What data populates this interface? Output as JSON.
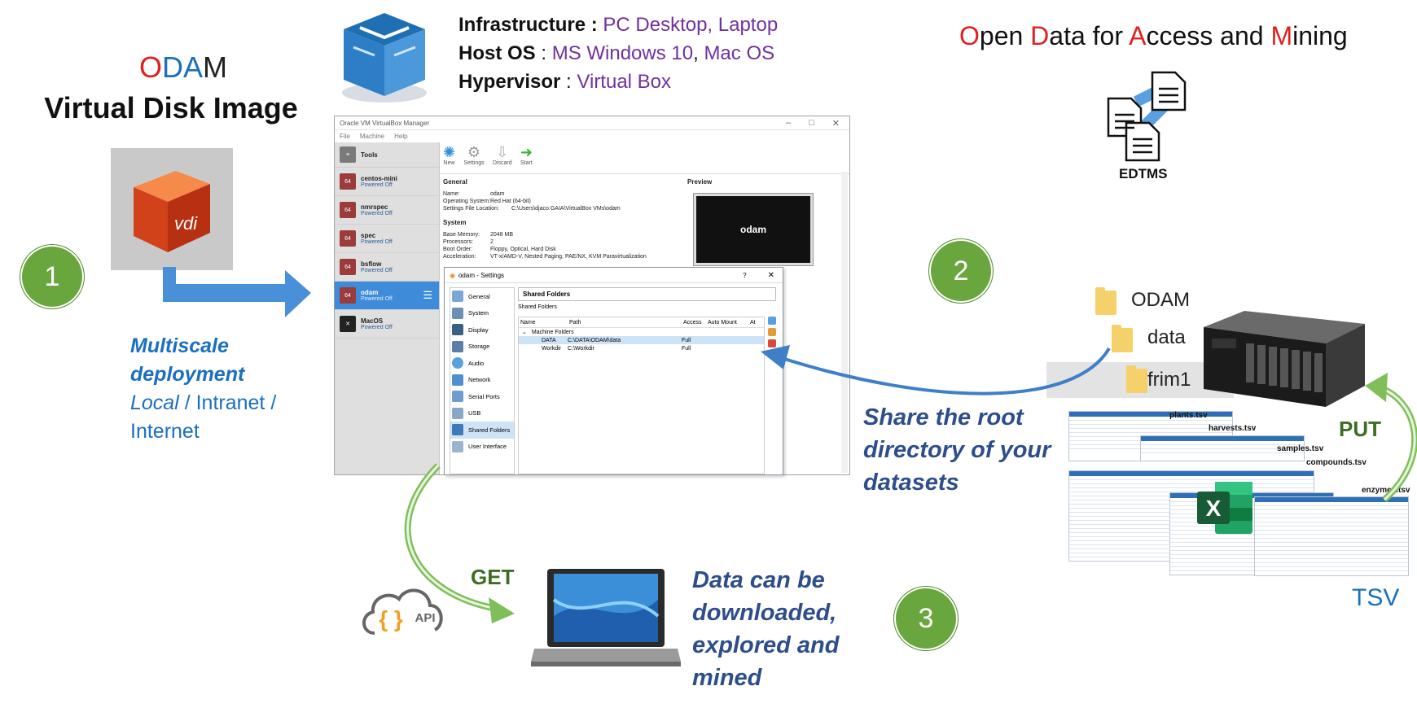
{
  "title": {
    "letters": [
      "O",
      "D",
      "A",
      "M"
    ],
    "subtitle": "Virtual Disk Image"
  },
  "vdi_icon_label": "vdi",
  "steps": [
    "1",
    "2",
    "3"
  ],
  "infra": {
    "infrastructure_label": "Infrastructure :",
    "infrastructure_value": "PC Desktop, Laptop",
    "hostos_label": "Host OS",
    "hostos_sep": " : ",
    "hostos_value1": "MS Windows 10",
    "hostos_comma": ", ",
    "hostos_value2": "Mac OS",
    "hypervisor_label": "Hypervisor",
    "hypervisor_sep": " : ",
    "hypervisor_value": "Virtual Box"
  },
  "odam_full": {
    "parts": [
      {
        "initial": "O",
        "rest": "pen "
      },
      {
        "initial": "D",
        "rest": "ata for "
      },
      {
        "initial": "A",
        "rest": "ccess and "
      },
      {
        "initial": "M",
        "rest": "ining"
      }
    ]
  },
  "edtms_label": "EDTMS",
  "deployment": {
    "line1": "Multiscale",
    "line2": "deployment",
    "local": "Local",
    "sep1": " / Intranet /",
    "internet": "Internet"
  },
  "vbox": {
    "window_title": "Oracle VM VirtualBox Manager",
    "menu": [
      "File",
      "Machine",
      "Help"
    ],
    "tools_label": "Tools",
    "vms": [
      {
        "name": "centos-mini",
        "state": "Powered Off"
      },
      {
        "name": "nmrspec",
        "state": "Powered Off"
      },
      {
        "name": "spec",
        "state": "Powered Off"
      },
      {
        "name": "bsflow",
        "state": "Powered Off"
      },
      {
        "name": "odam",
        "state": "Powered Off"
      },
      {
        "name": "MacOS",
        "state": "Powered Off"
      }
    ],
    "toolbar": [
      "New",
      "Settings",
      "Discard",
      "Start"
    ],
    "general_label": "General",
    "general": [
      {
        "k": "Name:",
        "v": "odam"
      },
      {
        "k": "Operating System:",
        "v": "Red Hat (64-bit)"
      },
      {
        "k": "Settings File Location:",
        "v": "C:\\Users\\djaco.GAIA\\VirtualBox VMs\\odam"
      }
    ],
    "system_label": "System",
    "system": [
      {
        "k": "Base Memory:",
        "v": "2048 MB"
      },
      {
        "k": "Processors:",
        "v": "2"
      },
      {
        "k": "Boot Order:",
        "v": "Floppy, Optical, Hard Disk"
      },
      {
        "k": "Acceleration:",
        "v": "VT-x/AMD-V, Nested Paging, PAE/NX, KVM Paravirtualization"
      }
    ],
    "preview_label": "Preview",
    "preview_name": "odam"
  },
  "settings": {
    "title": "odam - Settings",
    "help": "?",
    "close": "✕",
    "nav": [
      "General",
      "System",
      "Display",
      "Storage",
      "Audio",
      "Network",
      "Serial Ports",
      "USB",
      "Shared Folders",
      "User Interface"
    ],
    "header": "Shared Folders",
    "group_label": "Shared Folders",
    "columns": [
      "Name",
      "Path",
      "Access",
      "Auto Mount",
      "At"
    ],
    "machine_folders": "Machine Folders",
    "rows": [
      {
        "name": "DATA",
        "path": "C:\\DATA\\ODAM\\data",
        "access": "Full"
      },
      {
        "name": "Workdir",
        "path": "C:\\Workdir",
        "access": "Full"
      }
    ]
  },
  "folders": [
    "ODAM",
    "data",
    "frim1"
  ],
  "sheets": [
    "plants.tsv",
    "harvests.tsv",
    "samples.tsv",
    "compounds.tsv",
    "enzymes.tsv"
  ],
  "share_text": [
    "Share the root",
    "directory of your",
    "datasets"
  ],
  "put_label": "PUT",
  "get_label": "GET",
  "api_label": "API",
  "api_braces": "{ }",
  "tsv_label": "TSV",
  "excel_letter": "X",
  "data_text": [
    "Data can be",
    "downloaded,",
    "explored and",
    "mined"
  ],
  "colors": {
    "step_green": "#6aa63e",
    "arrow_blue": "#4a90d9",
    "arrow_green": "#7fbf5a",
    "text_blue": "#1a6fc0",
    "text_navy": "#2d4e8a",
    "text_purple": "#7030a0",
    "odam_red": "#e02020"
  }
}
